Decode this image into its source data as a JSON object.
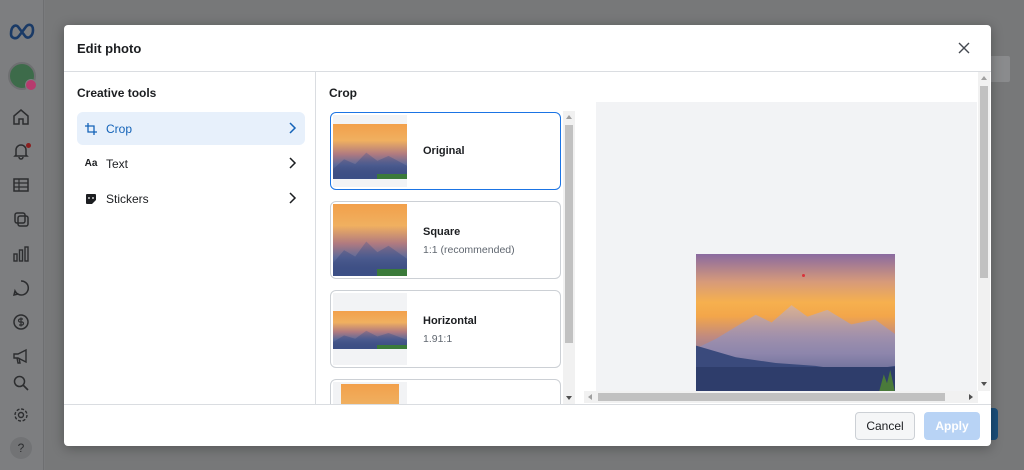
{
  "modal": {
    "title": "Edit photo",
    "close_icon": "close-icon"
  },
  "left_panel": {
    "title": "Creative tools",
    "tools": [
      {
        "label": "Crop",
        "icon": "crop-icon",
        "active": true
      },
      {
        "label": "Text",
        "icon": "text-icon",
        "active": false
      },
      {
        "label": "Stickers",
        "icon": "sticker-icon",
        "active": false
      }
    ]
  },
  "crop_panel": {
    "title": "Crop",
    "options": [
      {
        "title": "Original",
        "subtitle": "",
        "selected": true
      },
      {
        "title": "Square",
        "subtitle": "1:1 (recommended)",
        "selected": false
      },
      {
        "title": "Horizontal",
        "subtitle": "1.91:1",
        "selected": false
      }
    ]
  },
  "footer": {
    "cancel_label": "Cancel",
    "apply_label": "Apply"
  },
  "sidebar": {
    "icons": [
      "meta-logo-icon",
      "home-icon",
      "bell-icon",
      "table-icon",
      "pages-icon",
      "chart-icon",
      "chat-icon",
      "dollar-icon",
      "megaphone-icon",
      "search-icon",
      "gear-icon",
      "help-icon"
    ]
  },
  "colors": {
    "accent": "#1b74e4",
    "active_bg": "#e7f0fb",
    "apply_disabled": "#b8d3f5"
  }
}
